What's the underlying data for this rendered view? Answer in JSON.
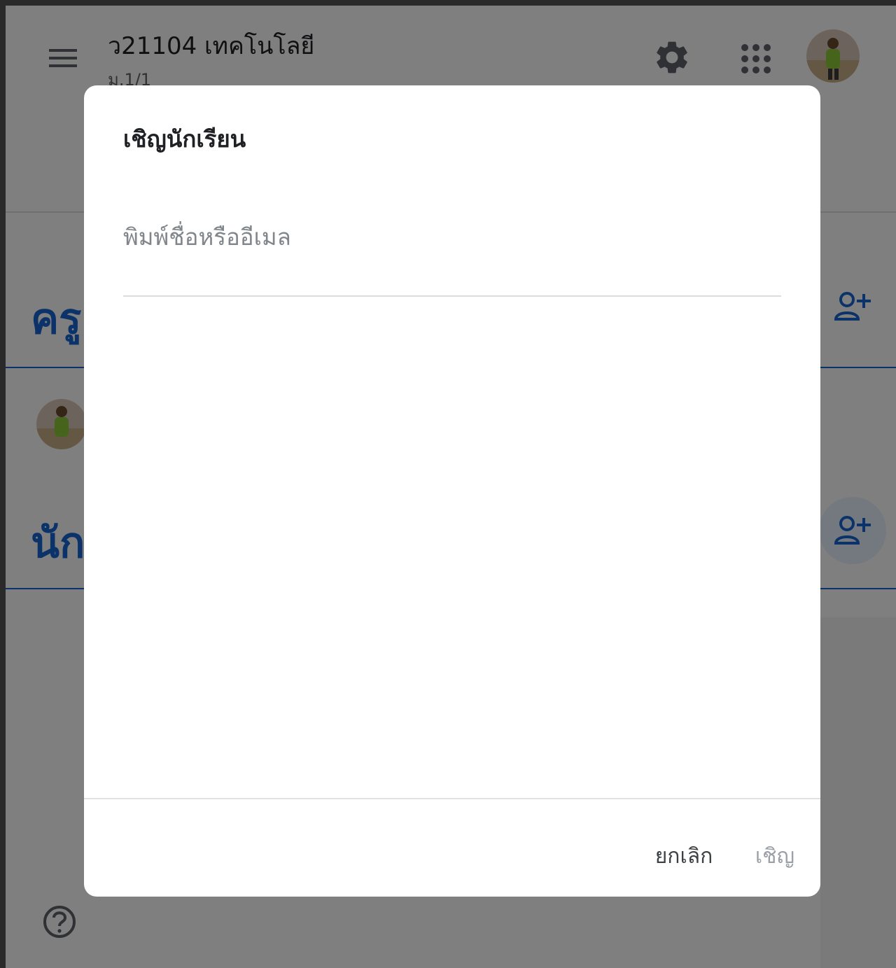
{
  "header": {
    "class_title": "ว21104 เทคโนโลยี",
    "class_subtitle": "ม.1/1"
  },
  "sections": {
    "teachers_title": "ครู",
    "students_title": "นักเรียน"
  },
  "dialog": {
    "title": "เชิญนักเรียน",
    "input_value": "",
    "input_placeholder": "พิมพ์ชื่อหรืออีเมล",
    "cancel_label": "ยกเลิก",
    "invite_label": "เชิญ"
  },
  "colors": {
    "accent": "#1967d2",
    "overlay": "rgba(0,0,0,0.5)",
    "disabled_text": "#9aa0a6"
  },
  "icons": {
    "menu": "menu-icon",
    "settings": "gear-icon",
    "apps": "apps-grid-icon",
    "add_person": "person-add-icon",
    "help": "help-icon"
  }
}
